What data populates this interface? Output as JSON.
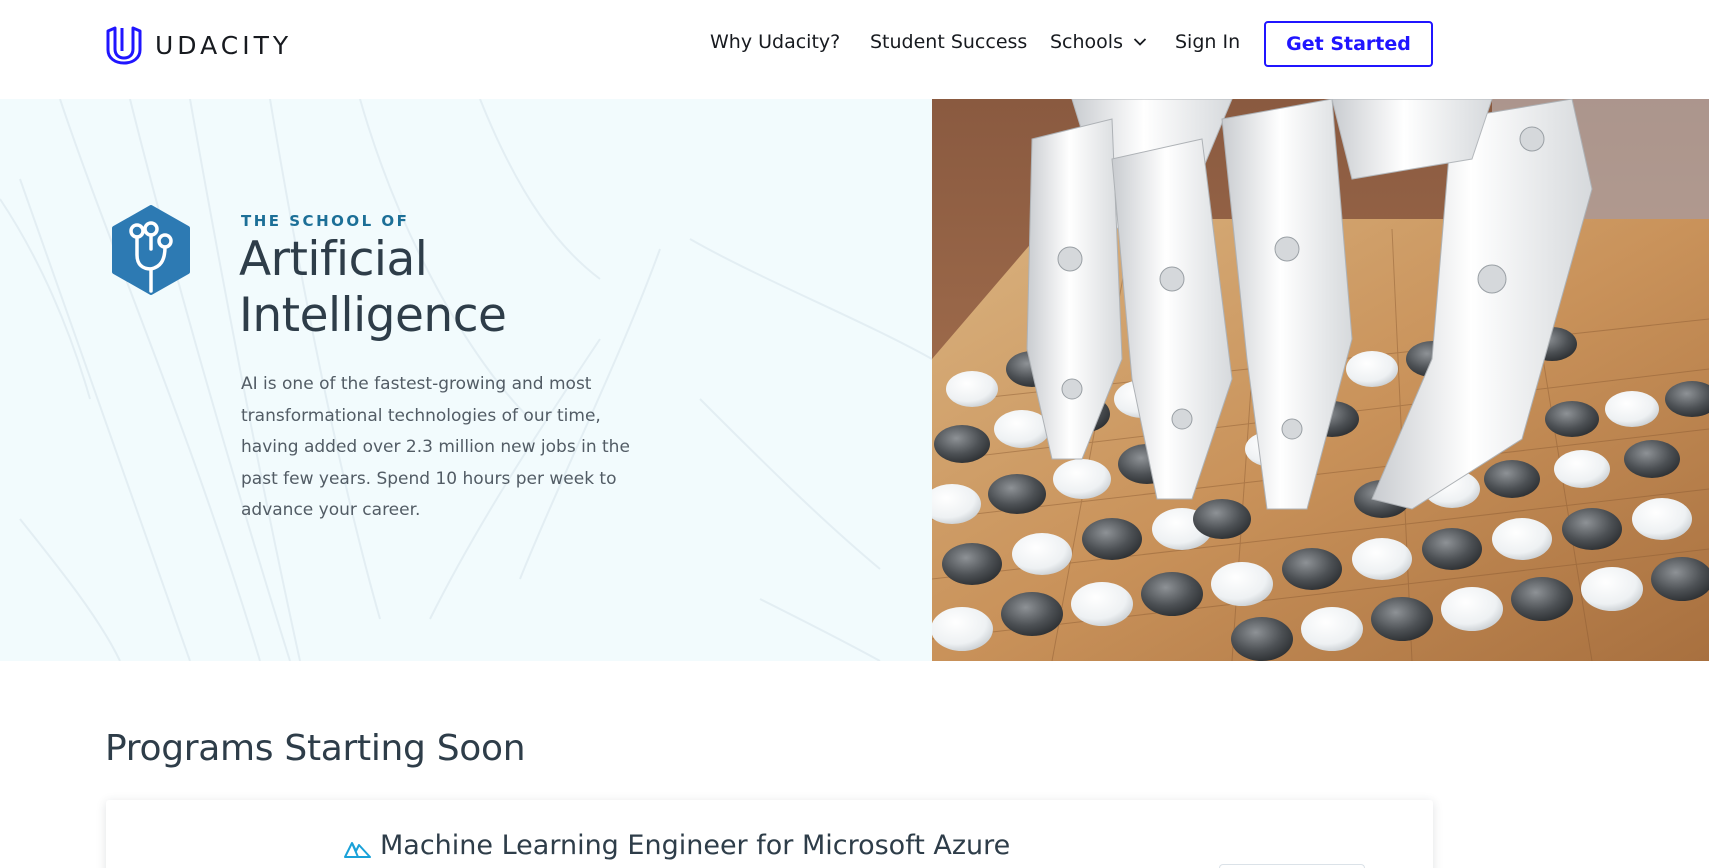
{
  "brand": {
    "name": "UDACITY",
    "accent_color": "#2015ff",
    "logo_icon": "udacity-u-logo-icon"
  },
  "nav": {
    "items": [
      {
        "label": "Why Udacity?"
      },
      {
        "label": "Student Success"
      },
      {
        "label": "Schools",
        "icon": "chevron-down-icon"
      },
      {
        "label": "Sign In"
      }
    ],
    "cta_label": "Get Started"
  },
  "hero": {
    "eyebrow": "THE SCHOOL OF",
    "title": "Artificial Intelligence",
    "description": "AI is one of the fastest-growing and most transformational technologies of our time, having added over 2.3 million new jobs in the past few years. Spend 10 hours per week to advance your career.",
    "school_icon": "ai-circuit-hexagon-icon",
    "image": "robot-hand-playing-go-image",
    "background_color": "#f2fbfd",
    "icon_color": "#2d7ab3"
  },
  "programs": {
    "title": "Programs Starting Soon",
    "items": [
      {
        "name": "Machine Learning Engineer for Microsoft Azure",
        "icon": "azure-logo-icon"
      }
    ]
  }
}
